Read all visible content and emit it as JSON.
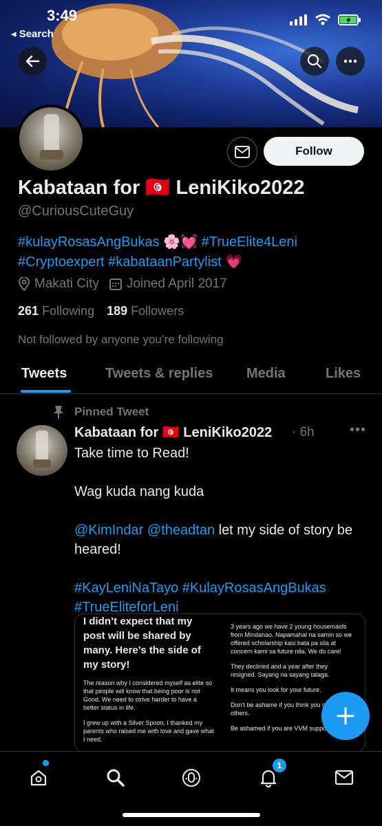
{
  "status_bar": {
    "time": "3:49",
    "back_label": "◂ Search"
  },
  "profile": {
    "name": "Kabataan for 🇹🇳 LeniKiko2022",
    "handle": "@CuriousCuteGuy",
    "bio_line1": "#kulayRosasAngBukas 🌸💓 #TrueElite4Leni",
    "bio_line2": "#Cryptoexpert #kabataanPartylist 💗",
    "location": "Makati City",
    "joined": "Joined April 2017",
    "following_count": "261",
    "following_label": "Following",
    "followers_count": "189",
    "followers_label": "Followers",
    "not_followed": "Not followed by anyone you’re following",
    "follow_button": "Follow"
  },
  "tabs": [
    {
      "label": "Tweets",
      "active": true
    },
    {
      "label": "Tweets & replies"
    },
    {
      "label": "Media"
    },
    {
      "label": "Likes"
    }
  ],
  "tweet": {
    "pinned_label": "Pinned Tweet",
    "author": "Kabataan for 🇹🇳 LeniKiko2022",
    "time": "· 6h",
    "line1": "Take time to Read!",
    "line2": "Wag kuda nang kuda",
    "mention1": "@KimIndar",
    "mention2": "@theadtan",
    "line3_rest": " let my side of story be heared!",
    "hashtags_line1": "#KayLeniNaTayo #KulayRosasAngBukas",
    "hashtags_line2": "#TrueEliteforLeni",
    "image": {
      "heading": "I didn’t expect that my post will be shared by many. Here’s the side of my story!",
      "p1": "The reason why I considered myself as elite so that people will know that  being poor is not Good. We need to strive harder to have a better status in life.",
      "p2": "I grew up with a Silver Spoon. I thanked my parents who raised me with love and gave what I need.",
      "c2p1": "3 years ago we have 2 young housemaids from Mindanao. Napamahal na samin so we offered scholarship kasi bata pa sila at concern kami sa future nila. We do care!",
      "c2p2": "They declined and a year after they resigned.  Sayang na sayang talaga.",
      "c2p3": "It means you look for your future.",
      "c2p4": "Don’t be ashame if you think you of the others.",
      "c2p5": "Be ashamed if you are VVM supporters a"
    }
  },
  "bottom_nav": {
    "notifications_badge": "1"
  },
  "colors": {
    "accent": "#1d9bf0",
    "background": "#000000",
    "muted": "#71767b"
  }
}
